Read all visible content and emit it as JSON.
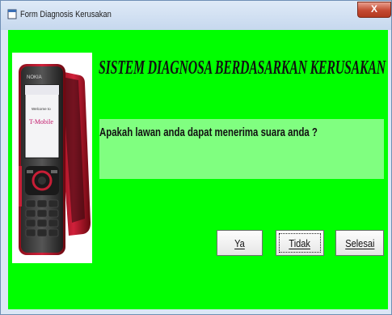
{
  "window": {
    "title": "Form Diagnosis Kerusakan",
    "close_label": "X"
  },
  "form": {
    "heading": "SISTEM DIAGNOSA BERDASARKAN KERUSAKAN",
    "question": "Apakah lawan anda dapat menerima suara anda ?",
    "image": {
      "icon": "nokia-phone-image",
      "brand_text": "NOKIA",
      "screen_text": "Welcome to",
      "logo_text": "T-Mobile"
    },
    "buttons": {
      "yes_label": "Ya",
      "no_label": "Tidak",
      "finish_label": "Selesai"
    }
  },
  "colors": {
    "form_background": "#00ff00",
    "question_background": "#80ff80",
    "titlebar": "#c6d8ee",
    "close_button": "#c44a32"
  }
}
